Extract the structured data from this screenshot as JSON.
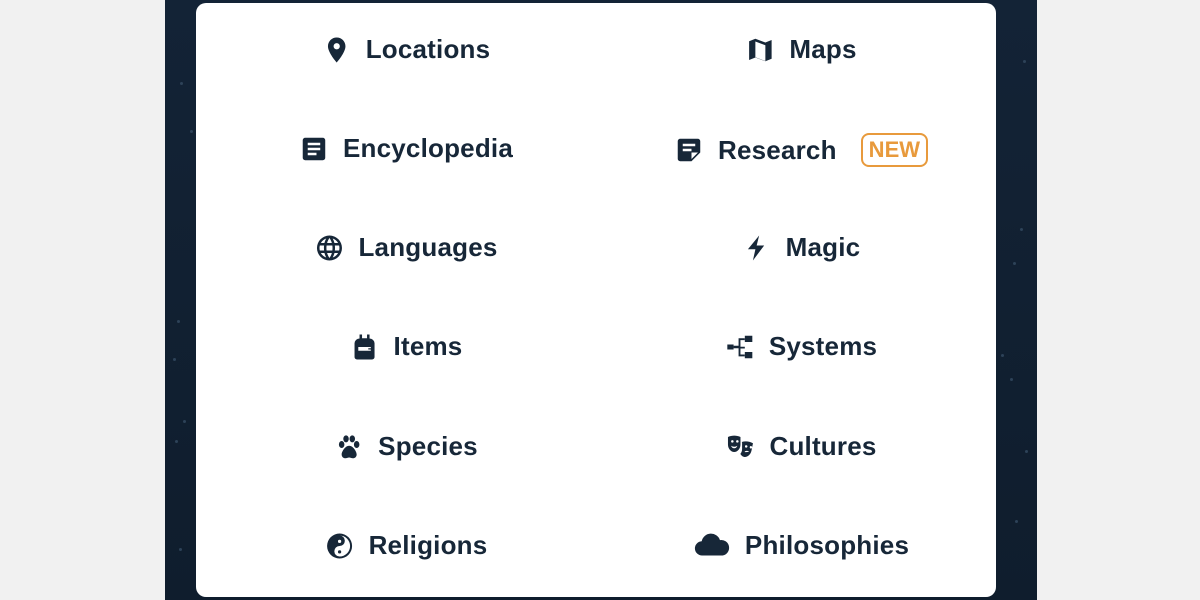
{
  "menu": {
    "left": [
      {
        "label": "Locations",
        "icon": "map-pin-icon"
      },
      {
        "label": "Encyclopedia",
        "icon": "document-icon"
      },
      {
        "label": "Languages",
        "icon": "globe-icon"
      },
      {
        "label": "Items",
        "icon": "backpack-icon"
      },
      {
        "label": "Species",
        "icon": "paw-icon"
      },
      {
        "label": "Religions",
        "icon": "yin-yang-icon"
      }
    ],
    "right": [
      {
        "label": "Maps",
        "icon": "map-icon"
      },
      {
        "label": "Research",
        "icon": "note-icon",
        "badge": "NEW"
      },
      {
        "label": "Magic",
        "icon": "lightning-icon"
      },
      {
        "label": "Systems",
        "icon": "hierarchy-icon"
      },
      {
        "label": "Cultures",
        "icon": "theater-masks-icon"
      },
      {
        "label": "Philosophies",
        "icon": "cloud-icon"
      }
    ]
  },
  "colors": {
    "text": "#172738",
    "badge": "#e89a3c",
    "page_bg": "#f1f1f1",
    "panel_bg": "#132336",
    "card_bg": "#ffffff"
  }
}
